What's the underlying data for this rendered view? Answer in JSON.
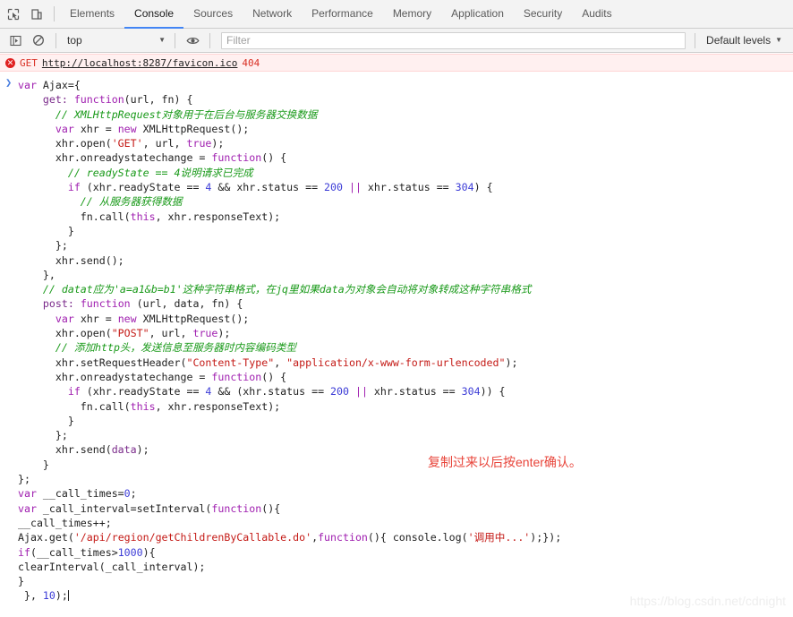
{
  "tabbar": {
    "icons": [
      {
        "name": "inspect-element-icon",
        "title": "Select an element in the page to inspect it"
      },
      {
        "name": "device-toolbar-icon",
        "title": "Toggle device toolbar"
      }
    ],
    "tabs": [
      {
        "label": "Elements",
        "active": false
      },
      {
        "label": "Console",
        "active": true
      },
      {
        "label": "Sources",
        "active": false
      },
      {
        "label": "Network",
        "active": false
      },
      {
        "label": "Performance",
        "active": false
      },
      {
        "label": "Memory",
        "active": false
      },
      {
        "label": "Application",
        "active": false
      },
      {
        "label": "Security",
        "active": false
      },
      {
        "label": "Audits",
        "active": false
      }
    ],
    "active_tab": "Console",
    "accent_color": "#4285f4"
  },
  "console_toolbar": {
    "sidebar_toggle_icon": "console-sidebar-icon",
    "clear_icon": "clear-console-icon",
    "context_value": "top",
    "context_caret": "▼",
    "eye_icon": "live-expression-icon",
    "filter_placeholder": "Filter",
    "filter_value": "",
    "levels_label": "Default levels",
    "levels_caret": "▼"
  },
  "messages": {
    "error": {
      "icon": "error-circle-icon",
      "method": "GET",
      "url": "http://localhost:8287/favicon.ico",
      "status": "404",
      "background": "#fff0f0",
      "text_color": "#d93025"
    },
    "prompt_arrow": "❯"
  },
  "code": {
    "lines": [
      [
        {
          "t": "var ",
          "c": "kw"
        },
        {
          "t": "Ajax={",
          "c": "plain"
        }
      ],
      [
        {
          "t": "    get: ",
          "c": "prop"
        },
        {
          "t": "function",
          "c": "kw"
        },
        {
          "t": "(url, fn) {",
          "c": "plain"
        }
      ],
      [
        {
          "t": "      // XMLHttpRequest对象用于在后台与服务器交换数据",
          "c": "cmt"
        }
      ],
      [
        {
          "t": "      ",
          "c": "plain"
        },
        {
          "t": "var ",
          "c": "kw"
        },
        {
          "t": "xhr = ",
          "c": "plain"
        },
        {
          "t": "new ",
          "c": "kw"
        },
        {
          "t": "XMLHttpRequest();",
          "c": "plain"
        }
      ],
      [
        {
          "t": "      xhr.open(",
          "c": "plain"
        },
        {
          "t": "'GET'",
          "c": "str"
        },
        {
          "t": ", url, ",
          "c": "plain"
        },
        {
          "t": "true",
          "c": "kw"
        },
        {
          "t": ");",
          "c": "plain"
        }
      ],
      [
        {
          "t": "      xhr.onreadystatechange = ",
          "c": "plain"
        },
        {
          "t": "function",
          "c": "kw"
        },
        {
          "t": "() {",
          "c": "plain"
        }
      ],
      [
        {
          "t": "        // readyState == 4说明请求已完成",
          "c": "cmt"
        }
      ],
      [
        {
          "t": "        ",
          "c": "plain"
        },
        {
          "t": "if ",
          "c": "kw"
        },
        {
          "t": "(xhr.readyState == ",
          "c": "plain"
        },
        {
          "t": "4",
          "c": "num"
        },
        {
          "t": " && xhr.status == ",
          "c": "plain"
        },
        {
          "t": "200",
          "c": "num"
        },
        {
          "t": " || ",
          "c": "kw"
        },
        {
          "t": "xhr.status == ",
          "c": "plain"
        },
        {
          "t": "304",
          "c": "num"
        },
        {
          "t": ") {",
          "c": "plain"
        }
      ],
      [
        {
          "t": "          // 从服务器获得数据",
          "c": "cmt"
        }
      ],
      [
        {
          "t": "          fn.call(",
          "c": "plain"
        },
        {
          "t": "this",
          "c": "kw"
        },
        {
          "t": ", xhr.responseText);",
          "c": "plain"
        }
      ],
      [
        {
          "t": "        }",
          "c": "plain"
        }
      ],
      [
        {
          "t": "      };",
          "c": "plain"
        }
      ],
      [
        {
          "t": "      xhr.send();",
          "c": "plain"
        }
      ],
      [
        {
          "t": "    },",
          "c": "plain"
        }
      ],
      [
        {
          "t": "    // datat应为'a=a1&b=b1'这种字符串格式，在jq里如果data为对象会自动将对象转成这种字符串格式",
          "c": "cmt"
        }
      ],
      [
        {
          "t": "    post: ",
          "c": "prop"
        },
        {
          "t": "function ",
          "c": "kw"
        },
        {
          "t": "(url, data, fn) {",
          "c": "plain"
        }
      ],
      [
        {
          "t": "      ",
          "c": "plain"
        },
        {
          "t": "var ",
          "c": "kw"
        },
        {
          "t": "xhr = ",
          "c": "plain"
        },
        {
          "t": "new ",
          "c": "kw"
        },
        {
          "t": "XMLHttpRequest();",
          "c": "plain"
        }
      ],
      [
        {
          "t": "      xhr.open(",
          "c": "plain"
        },
        {
          "t": "\"POST\"",
          "c": "str"
        },
        {
          "t": ", url, ",
          "c": "plain"
        },
        {
          "t": "true",
          "c": "kw"
        },
        {
          "t": ");",
          "c": "plain"
        }
      ],
      [
        {
          "t": "      // 添加http头，发送信息至服务器时内容编码类型",
          "c": "cmt"
        }
      ],
      [
        {
          "t": "      xhr.setRequestHeader(",
          "c": "plain"
        },
        {
          "t": "\"Content-Type\"",
          "c": "str"
        },
        {
          "t": ", ",
          "c": "plain"
        },
        {
          "t": "\"application/x-www-form-urlencoded\"",
          "c": "str"
        },
        {
          "t": ");",
          "c": "plain"
        }
      ],
      [
        {
          "t": "      xhr.onreadystatechange = ",
          "c": "plain"
        },
        {
          "t": "function",
          "c": "kw"
        },
        {
          "t": "() {",
          "c": "plain"
        }
      ],
      [
        {
          "t": "        ",
          "c": "plain"
        },
        {
          "t": "if ",
          "c": "kw"
        },
        {
          "t": "(xhr.readyState == ",
          "c": "plain"
        },
        {
          "t": "4",
          "c": "num"
        },
        {
          "t": " && (xhr.status == ",
          "c": "plain"
        },
        {
          "t": "200",
          "c": "num"
        },
        {
          "t": " || ",
          "c": "kw"
        },
        {
          "t": "xhr.status == ",
          "c": "plain"
        },
        {
          "t": "304",
          "c": "num"
        },
        {
          "t": ")) {",
          "c": "plain"
        }
      ],
      [
        {
          "t": "          fn.call(",
          "c": "plain"
        },
        {
          "t": "this",
          "c": "kw"
        },
        {
          "t": ", xhr.responseText);",
          "c": "plain"
        }
      ],
      [
        {
          "t": "        }",
          "c": "plain"
        }
      ],
      [
        {
          "t": "      };",
          "c": "plain"
        }
      ],
      [
        {
          "t": "      xhr.send(",
          "c": "plain"
        },
        {
          "t": "data",
          "c": "prop"
        },
        {
          "t": ");",
          "c": "plain"
        }
      ],
      [
        {
          "t": "    }",
          "c": "plain"
        }
      ],
      [
        {
          "t": "};",
          "c": "plain"
        }
      ],
      [
        {
          "t": "var ",
          "c": "kw"
        },
        {
          "t": "__call_times=",
          "c": "plain"
        },
        {
          "t": "0",
          "c": "num"
        },
        {
          "t": ";",
          "c": "plain"
        }
      ],
      [
        {
          "t": "var ",
          "c": "kw"
        },
        {
          "t": "_call_interval=setInterval(",
          "c": "plain"
        },
        {
          "t": "function",
          "c": "kw"
        },
        {
          "t": "(){",
          "c": "plain"
        }
      ],
      [
        {
          "t": "__call_times++;",
          "c": "plain"
        }
      ],
      [
        {
          "t": "Ajax.get(",
          "c": "plain"
        },
        {
          "t": "'/api/region/getChildrenByCallable.do'",
          "c": "str"
        },
        {
          "t": ",",
          "c": "plain"
        },
        {
          "t": "function",
          "c": "kw"
        },
        {
          "t": "(){ console.log(",
          "c": "plain"
        },
        {
          "t": "'调用中...'",
          "c": "str"
        },
        {
          "t": ");});",
          "c": "plain"
        }
      ],
      [
        {
          "t": "if",
          "c": "kw"
        },
        {
          "t": "(__call_times>",
          "c": "plain"
        },
        {
          "t": "1000",
          "c": "num"
        },
        {
          "t": "){",
          "c": "plain"
        }
      ],
      [
        {
          "t": "clearInterval(_call_interval);",
          "c": "plain"
        }
      ],
      [
        {
          "t": "}",
          "c": "plain"
        }
      ],
      [
        {
          "t": " }, ",
          "c": "plain"
        },
        {
          "t": "10",
          "c": "num"
        },
        {
          "t": ");",
          "c": "plain"
        }
      ]
    ]
  },
  "annotation": {
    "text": "复制过来以后按enter确认。",
    "color": "#e8443a"
  },
  "watermark": {
    "text": "https://blog.csdn.net/cdnight"
  }
}
